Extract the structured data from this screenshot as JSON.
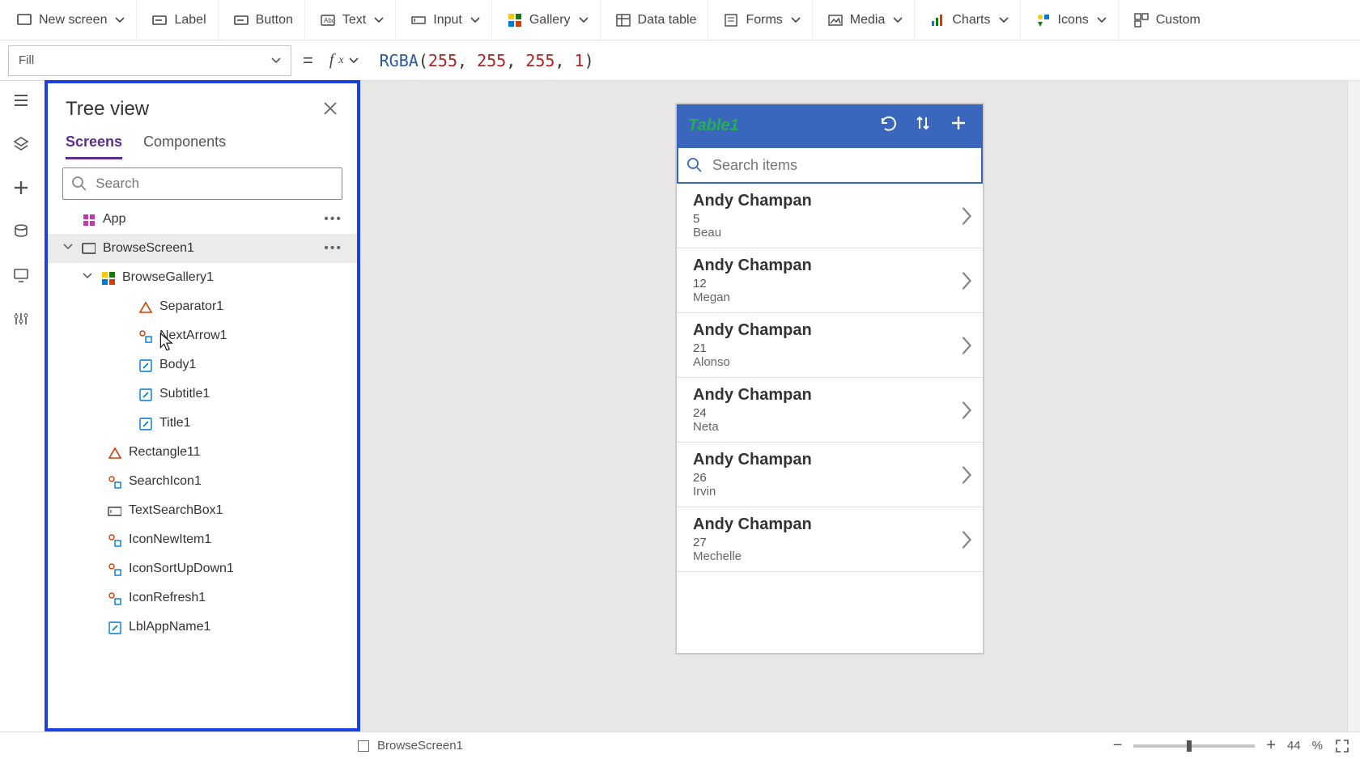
{
  "ribbon": {
    "new_screen": "New screen",
    "label": "Label",
    "button": "Button",
    "text": "Text",
    "input": "Input",
    "gallery": "Gallery",
    "data_table": "Data table",
    "forms": "Forms",
    "media": "Media",
    "charts": "Charts",
    "icons": "Icons",
    "custom": "Custom"
  },
  "property": {
    "selected": "Fill",
    "formula_fn": "RGBA",
    "formula_args": [
      "255",
      "255",
      "255",
      "1"
    ]
  },
  "tree": {
    "title": "Tree view",
    "tab_screens": "Screens",
    "tab_components": "Components",
    "search_placeholder": "Search",
    "nodes": {
      "app": "App",
      "browseScreen": "BrowseScreen1",
      "browseGallery": "BrowseGallery1",
      "separator": "Separator1",
      "nextArrow": "NextArrow1",
      "body": "Body1",
      "subtitle": "Subtitle1",
      "title": "Title1",
      "rectangle": "Rectangle11",
      "searchIcon": "SearchIcon1",
      "textSearchBox": "TextSearchBox1",
      "iconNewItem": "IconNewItem1",
      "iconSortUpDown": "IconSortUpDown1",
      "iconRefresh": "IconRefresh1",
      "lblAppName": "LblAppName1"
    }
  },
  "phone": {
    "title": "Table1",
    "search_placeholder": "Search items",
    "items": [
      {
        "name": "Andy Champan",
        "num": "5",
        "sub": "Beau"
      },
      {
        "name": "Andy Champan",
        "num": "12",
        "sub": "Megan"
      },
      {
        "name": "Andy Champan",
        "num": "21",
        "sub": "Alonso"
      },
      {
        "name": "Andy Champan",
        "num": "24",
        "sub": "Neta"
      },
      {
        "name": "Andy Champan",
        "num": "26",
        "sub": "Irvin"
      },
      {
        "name": "Andy Champan",
        "num": "27",
        "sub": "Mechelle"
      }
    ]
  },
  "status": {
    "screen": "BrowseScreen1",
    "zoom": "44",
    "pct": "%"
  }
}
